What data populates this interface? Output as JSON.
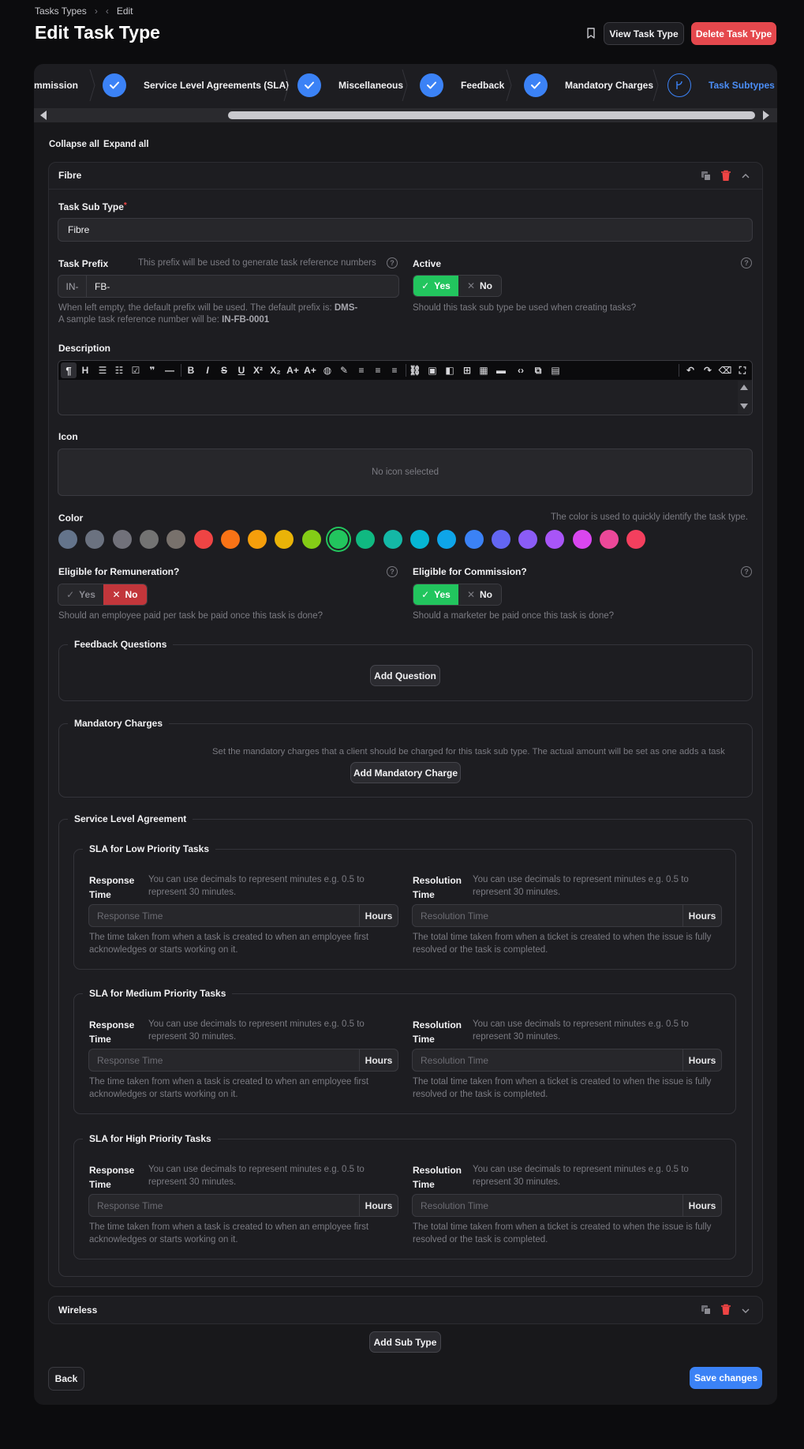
{
  "breadcrumb": {
    "parent": "Tasks Types",
    "current": "Edit"
  },
  "page_title": "Edit Task Type",
  "header": {
    "view_button": "View Task Type",
    "delete_button": "Delete Task Type"
  },
  "steps": [
    {
      "label": "mmission",
      "state": "partial"
    },
    {
      "label": "Service Level Agreements (SLA)",
      "state": "complete"
    },
    {
      "label": "Miscellaneous",
      "state": "complete"
    },
    {
      "label": "Feedback",
      "state": "complete"
    },
    {
      "label": "Mandatory Charges",
      "state": "complete"
    },
    {
      "label": "Task Subtypes",
      "state": "current"
    }
  ],
  "controls": {
    "collapse_all": "Collapse all",
    "expand_all": "Expand all"
  },
  "subtype": {
    "title": "Fibre",
    "task_sub_type": {
      "label": "Task Sub Type",
      "required_mark": "*",
      "value": "Fibre"
    },
    "task_prefix": {
      "label": "Task Prefix",
      "hint": "This prefix will be used to generate task reference numbers",
      "addon": "IN-",
      "value": "FB-",
      "help_line1": "When left empty, the default prefix will be used. The default prefix is:",
      "default_prefix": "DMS-",
      "help_line2": "A sample task reference number will be:",
      "sample": "IN-FB-0001"
    },
    "active": {
      "label": "Active",
      "yes": "Yes",
      "no": "No",
      "selected": "Yes",
      "help": "Should this task sub type be used when creating tasks?"
    },
    "description": {
      "label": "Description"
    },
    "icon": {
      "label": "Icon",
      "empty": "No icon selected"
    },
    "color": {
      "label": "Color",
      "hint": "The color is used to quickly identify the task type.",
      "swatches": [
        "#64748b",
        "#6b7280",
        "#71717a",
        "#737373",
        "#78716c",
        "#ef4444",
        "#f97316",
        "#f59e0b",
        "#eab308",
        "#84cc16",
        "#22c55e",
        "#10b981",
        "#14b8a6",
        "#06b6d4",
        "#0ea5e9",
        "#3b82f6",
        "#6366f1",
        "#8b5cf6",
        "#a855f7",
        "#d946ef",
        "#ec4899",
        "#f43f5e"
      ],
      "selected_index": 10
    },
    "remuneration": {
      "label": "Eligible for Remuneration?",
      "yes": "Yes",
      "no": "No",
      "selected": "No",
      "help": "Should an employee paid per task be paid once this task is done?"
    },
    "commission": {
      "label": "Eligible for Commission?",
      "yes": "Yes",
      "no": "No",
      "selected": "Yes",
      "help": "Should a marketer be paid once this task is done?"
    },
    "feedback": {
      "legend": "Feedback Questions",
      "add_button": "Add Question"
    },
    "mandatory": {
      "legend": "Mandatory Charges",
      "help": "Set the mandatory charges that a client should be charged for this task sub type. The actual amount will be set as one adds a task",
      "add_button": "Add Mandatory Charge"
    },
    "sla": {
      "legend": "Service Level Agreement",
      "blocks": [
        {
          "title": "SLA for Low Priority Tasks"
        },
        {
          "title": "SLA for Medium Priority Tasks"
        },
        {
          "title": "SLA for High Priority Tasks"
        }
      ],
      "response": {
        "label_line1": "Response",
        "label_line2": "Time",
        "hint_line1": "You can use decimals to represent minutes e.g. 0.5 to",
        "hint_line2": "represent 30 minutes.",
        "placeholder": "Response Time",
        "unit": "Hours",
        "help_line1": "The time taken from when a task is created to when an employee first",
        "help_line2": "acknowledges or starts working on it."
      },
      "resolution": {
        "label_line1": "Resolution",
        "label_line2": "Time",
        "hint_line1": "You can use decimals to represent minutes e.g. 0.5 to",
        "hint_line2": "represent 30 minutes.",
        "placeholder": "Resolution Time",
        "unit": "Hours",
        "help_line1": "The total time taken from when a ticket is created to when the issue is fully",
        "help_line2": "resolved or the task is completed."
      }
    }
  },
  "subtype2": {
    "title": "Wireless"
  },
  "footer": {
    "add_sub_type": "Add Sub Type",
    "back": "Back",
    "save": "Save changes"
  },
  "icons": {
    "breadcrumb_sep": "chevron-right-icon",
    "back": "chevron-left-icon",
    "bookmark": "bookmark-icon",
    "copy": "copy-icon",
    "delete": "trash-icon",
    "collapse": "chevron-up-icon",
    "expand": "chevron-down-icon",
    "check": "check-icon",
    "x": "x-icon"
  }
}
